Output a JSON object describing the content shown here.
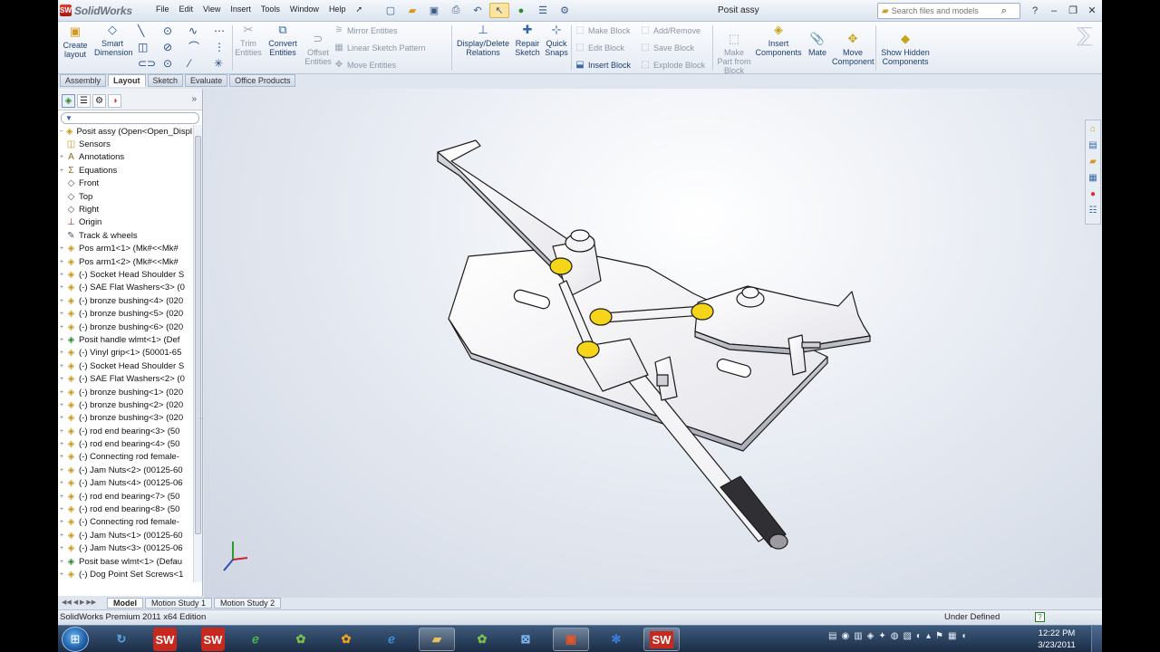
{
  "app": {
    "title": "SolidWorks",
    "doc_title": "Posit assy",
    "logo_mark": "SW"
  },
  "menu": [
    "File",
    "Edit",
    "View",
    "Insert",
    "Tools",
    "Window",
    "Help"
  ],
  "quick_icons": [
    "new-file-icon",
    "open-folder-icon",
    "save-icon",
    "print-icon",
    "undo-icon",
    "select-arrow-icon",
    "rebuild-icon",
    "file-properties-icon",
    "options-icon"
  ],
  "search": {
    "placeholder": "Search files and models"
  },
  "ribbon": {
    "create_layout": "Create layout",
    "smart_dimension": "Smart Dimension",
    "trim_entities": "Trim Entities",
    "convert_entities": "Convert Entities",
    "offset_entities": "Offset Entities",
    "mirror_entities": "Mirror Entities",
    "linear_sketch_pattern": "Linear Sketch Pattern",
    "move_entities": "Move Entities",
    "display_delete_relations": "Display/Delete Relations",
    "repair_sketch": "Repair Sketch",
    "quick_snaps": "Quick Snaps",
    "make_block": "Make Block",
    "edit_block": "Edit Block",
    "insert_block": "Insert Block",
    "add_remove": "Add/Remove",
    "save_block": "Save Block",
    "explode_block": "Explode Block",
    "make_part_from_block": "Make Part from Block",
    "insert_components": "Insert Components",
    "mate": "Mate",
    "move_component": "Move Component",
    "show_hidden_components": "Show Hidden Components"
  },
  "command_tabs": [
    "Assembly",
    "Layout",
    "Sketch",
    "Evaluate",
    "Office Products"
  ],
  "active_command_tab": "Layout",
  "feature_tree": [
    {
      "label": "Posit assy  (Open<Open_Displ",
      "icon": "assembly-icon",
      "exp": "−"
    },
    {
      "label": "Sensors",
      "icon": "sensors-icon",
      "exp": ""
    },
    {
      "label": "Annotations",
      "icon": "annotations-icon",
      "exp": "+"
    },
    {
      "label": "Equations",
      "icon": "equations-icon",
      "exp": "+"
    },
    {
      "label": "Front",
      "icon": "plane-icon",
      "exp": ""
    },
    {
      "label": "Top",
      "icon": "plane-icon",
      "exp": ""
    },
    {
      "label": "Right",
      "icon": "plane-icon",
      "exp": ""
    },
    {
      "label": "Origin",
      "icon": "origin-icon",
      "exp": ""
    },
    {
      "label": "Track & wheels",
      "icon": "sketch-icon",
      "exp": ""
    },
    {
      "label": "Pos arm1<1> (Mk#<<Mk#",
      "icon": "part-icon",
      "exp": "+"
    },
    {
      "label": "Pos arm1<2> (Mk#<<Mk#",
      "icon": "part-icon",
      "exp": "+"
    },
    {
      "label": "(-) Socket Head Shoulder S",
      "icon": "part-icon",
      "exp": "+"
    },
    {
      "label": "(-) SAE Flat Washers<3> (0",
      "icon": "part-icon",
      "exp": "+"
    },
    {
      "label": "(-) bronze bushing<4> (020",
      "icon": "part-icon",
      "exp": "+"
    },
    {
      "label": "(-) bronze bushing<5> (020",
      "icon": "part-icon",
      "exp": "+"
    },
    {
      "label": "(-) bronze bushing<6> (020",
      "icon": "part-icon",
      "exp": "+"
    },
    {
      "label": "Posit handle wlmt<1> (Def",
      "icon": "weldment-icon",
      "exp": "+"
    },
    {
      "label": "(-) Vinyl grip<1> (50001-65",
      "icon": "part-icon",
      "exp": "+"
    },
    {
      "label": "(-) Socket Head Shoulder S",
      "icon": "part-icon",
      "exp": "+"
    },
    {
      "label": "(-) SAE Flat Washers<2> (0",
      "icon": "part-icon",
      "exp": "+"
    },
    {
      "label": "(-) bronze bushing<1> (020",
      "icon": "part-icon",
      "exp": "+"
    },
    {
      "label": "(-) bronze bushing<2> (020",
      "icon": "part-icon",
      "exp": "+"
    },
    {
      "label": "(-) bronze bushing<3> (020",
      "icon": "part-icon",
      "exp": "+"
    },
    {
      "label": "(-) rod end bearing<3> (50",
      "icon": "part-icon",
      "exp": "+"
    },
    {
      "label": "(-) rod end bearing<4> (50",
      "icon": "part-icon",
      "exp": "+"
    },
    {
      "label": "(-) Connecting rod female-",
      "icon": "part-icon",
      "exp": "+"
    },
    {
      "label": "(-) Jam Nuts<2> (00125-60",
      "icon": "part-icon",
      "exp": "+"
    },
    {
      "label": "(-) Jam Nuts<4> (00125-06",
      "icon": "part-icon",
      "exp": "+"
    },
    {
      "label": "(-) rod end bearing<7> (50",
      "icon": "part-icon",
      "exp": "+"
    },
    {
      "label": "(-) rod end bearing<8> (50",
      "icon": "part-icon",
      "exp": "+"
    },
    {
      "label": "(-) Connecting rod female-",
      "icon": "part-icon",
      "exp": "+"
    },
    {
      "label": "(-) Jam Nuts<1> (00125-60",
      "icon": "part-icon",
      "exp": "+"
    },
    {
      "label": "(-) Jam Nuts<3> (00125-06",
      "icon": "part-icon",
      "exp": "+"
    },
    {
      "label": "Posit base wlmt<1> (Defau",
      "icon": "weldment-icon",
      "exp": "+"
    },
    {
      "label": "(-) Dog Point Set Screws<1",
      "icon": "part-icon",
      "exp": "+"
    }
  ],
  "bottom_tabs": [
    "Model",
    "Motion Study 1",
    "Motion Study 2"
  ],
  "status": {
    "left": "SolidWorks Premium 2011 x64 Edition",
    "right": "Under Defined",
    "help": "?"
  },
  "clock": {
    "time": "12:22 PM",
    "date": "3/23/2011"
  },
  "colors": {
    "bushing": "#f5d51a",
    "parts": "#f4f4f6",
    "edge": "#1a1a1a",
    "accent": "#3466a8"
  }
}
